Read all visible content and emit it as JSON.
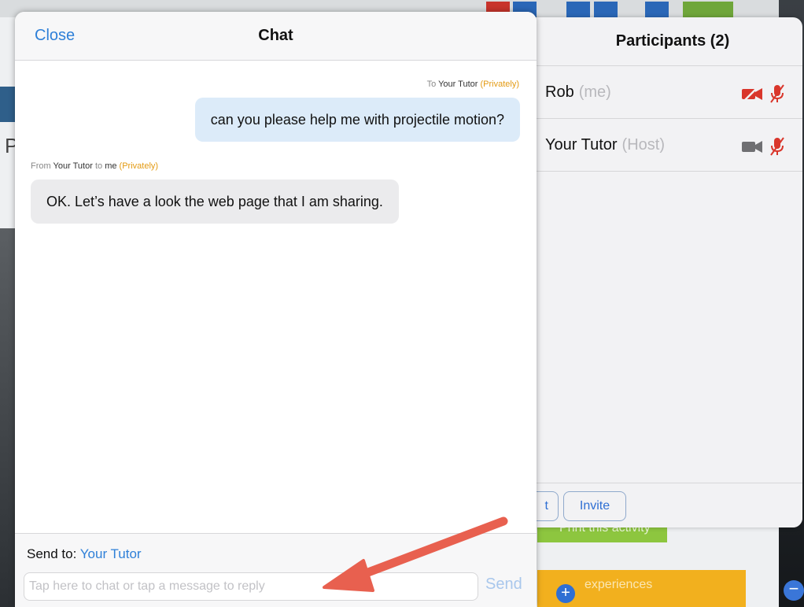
{
  "chat": {
    "close_label": "Close",
    "title": "Chat",
    "messages": [
      {
        "direction": "outgoing",
        "meta_prefix": "To",
        "meta_name": "Your Tutor",
        "meta_privacy": "(Privately)",
        "text": "can you please help me with projectile motion?"
      },
      {
        "direction": "incoming",
        "meta_prefix": "From",
        "meta_name": "Your Tutor",
        "meta_to": "to",
        "meta_recipient": "me",
        "meta_privacy": "(Privately)",
        "text": "OK. Let’s have a look the web page that I am sharing."
      }
    ],
    "send_to_label": "Send to:",
    "send_to_target": "Your Tutor",
    "input_value": "",
    "input_placeholder": "Tap here to chat or tap a message to reply",
    "send_label": "Send"
  },
  "participants": {
    "title": "Participants (2)",
    "list": [
      {
        "name": "Rob",
        "role": "(me)",
        "video_icon": "video-off-icon",
        "audio_icon": "mic-muted-icon"
      },
      {
        "name": "Your Tutor",
        "role": "(Host)",
        "video_icon": "video-icon",
        "audio_icon": "mic-muted-icon"
      }
    ],
    "footer_buttons": [
      {
        "label": "t"
      },
      {
        "label": "Invite"
      }
    ]
  },
  "background": {
    "visible_fragment": "Print this activity",
    "visible_fragment_2": "experiences",
    "visible_fragment_3": "P"
  },
  "colors": {
    "accent_blue": "#2f80d8",
    "privately_orange": "#e39a12",
    "muted_red": "#d9362b",
    "outgoing_bubble": "#dcebf9",
    "incoming_bubble": "#ebebed",
    "annotation_arrow": "#e8604f"
  }
}
